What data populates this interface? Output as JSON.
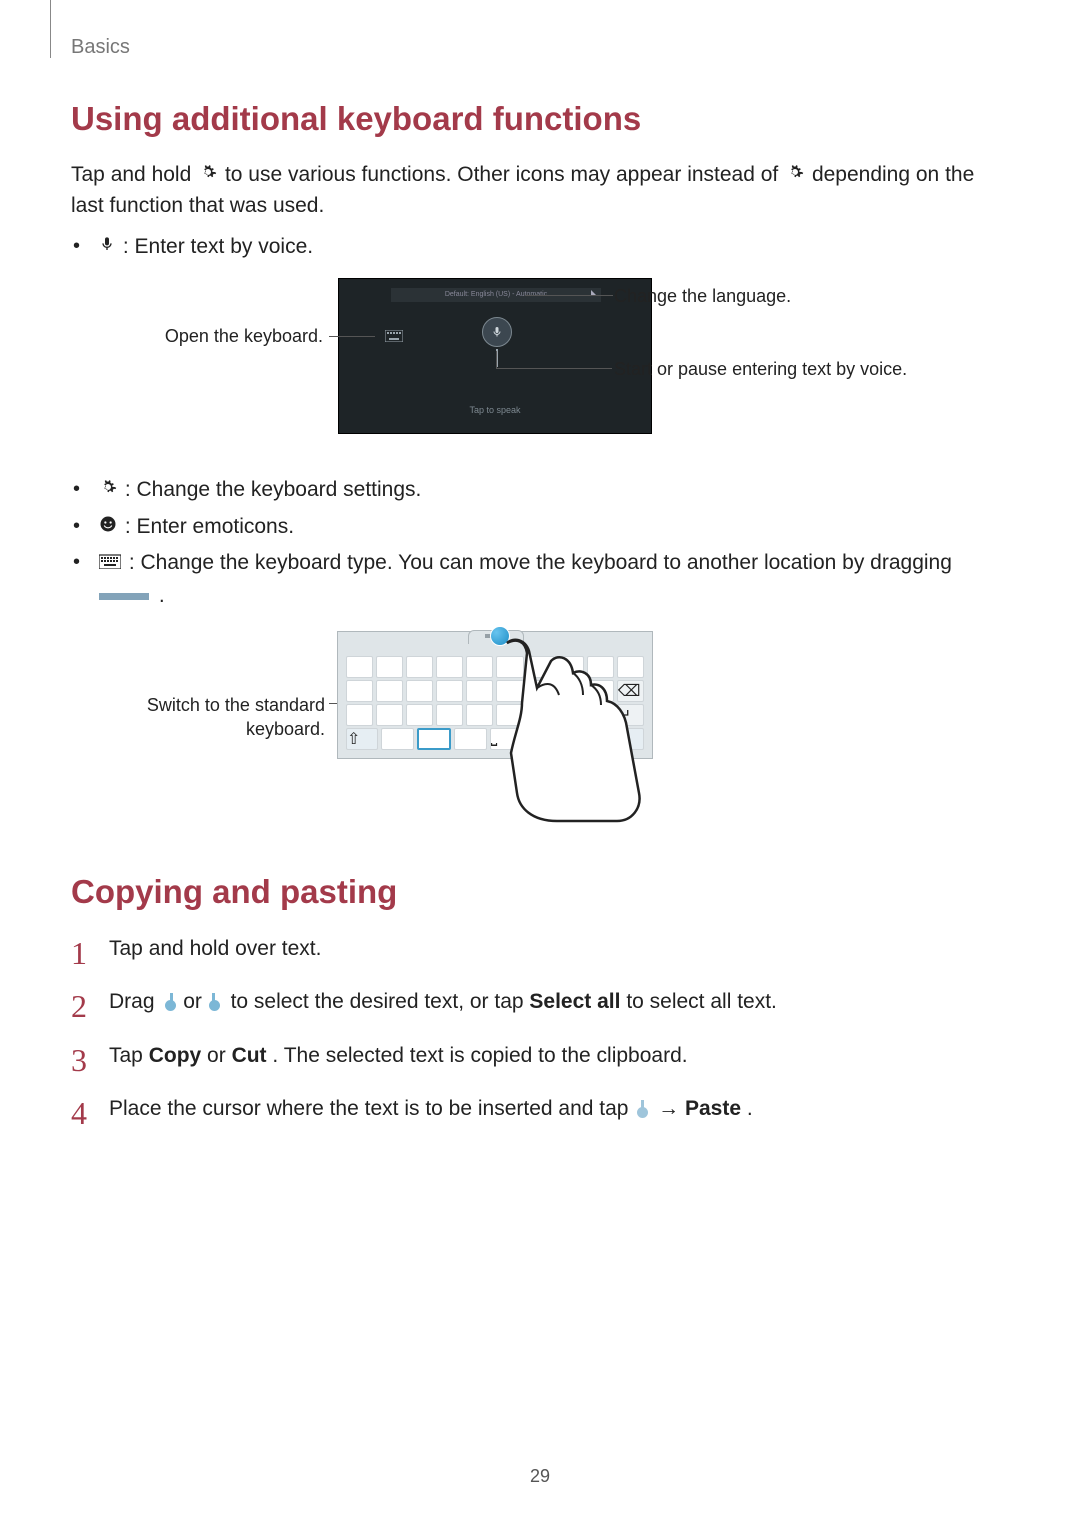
{
  "breadcrumb": "Basics",
  "page_number": "29",
  "section1": {
    "heading": "Using additional keyboard functions",
    "intro_a": "Tap and hold ",
    "intro_b": " to use various functions. Other icons may appear instead of ",
    "intro_c": " depending on the last function that was used.",
    "bullets": {
      "voice": " : Enter text by voice.",
      "settings": " : Change the keyboard settings.",
      "emoticons": " : Enter emoticons.",
      "kbtype_a": " : Change the keyboard type. You can move the keyboard to another location by dragging ",
      "kbtype_b": " ."
    },
    "figure1": {
      "open_keyboard": "Open the keyboard.",
      "change_language": "Change the language.",
      "start_pause": "Start or pause entering text by voice.",
      "tap_to_speak": "Tap to speak",
      "lang_preview": "Default: English (US) - Automatic"
    },
    "figure2": {
      "switch_standard": "Switch to the standard keyboard."
    }
  },
  "section2": {
    "heading": "Copying and pasting",
    "steps": {
      "s1": "Tap and hold over text.",
      "s2_a": "Drag ",
      "s2_b": " or ",
      "s2_c": " to select the desired text, or tap ",
      "s2_d": "Select all",
      "s2_e": " to select all text.",
      "s3_a": "Tap ",
      "s3_b": "Copy",
      "s3_c": " or ",
      "s3_d": "Cut",
      "s3_e": ". The selected text is copied to the clipboard.",
      "s4_a": "Place the cursor where the text is to be inserted and tap ",
      "s4_b": " → ",
      "s4_c": "Paste",
      "s4_d": "."
    }
  }
}
